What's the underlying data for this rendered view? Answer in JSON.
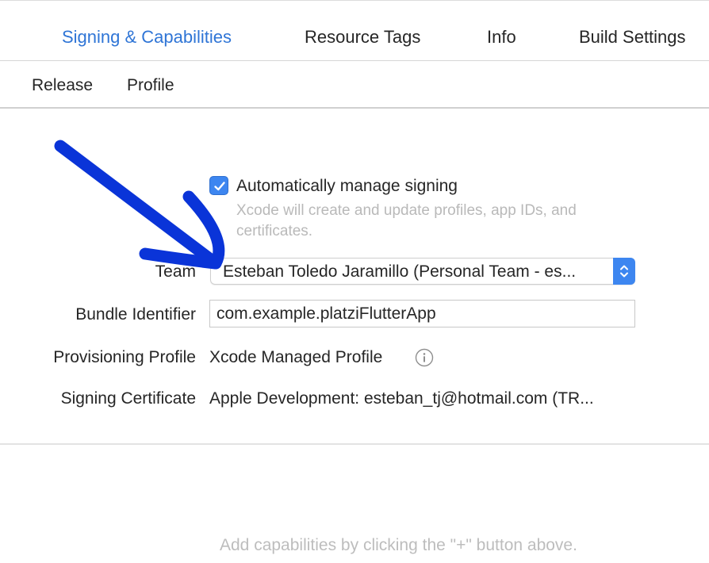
{
  "tabs": [
    {
      "label": "Signing & Capabilities",
      "active": true
    },
    {
      "label": "Resource Tags",
      "active": false
    },
    {
      "label": "Info",
      "active": false
    },
    {
      "label": "Build Settings",
      "active": false
    }
  ],
  "config_tabs": [
    {
      "label": "Release"
    },
    {
      "label": "Profile"
    }
  ],
  "signing": {
    "auto_manage": {
      "checked": true,
      "label": "Automatically manage signing",
      "description": "Xcode will create and update profiles, app IDs, and certificates."
    },
    "team": {
      "label": "Team",
      "value": "Esteban Toledo Jaramillo (Personal Team - es..."
    },
    "bundle_identifier": {
      "label": "Bundle Identifier",
      "value": "com.example.platziFlutterApp"
    },
    "provisioning_profile": {
      "label": "Provisioning Profile",
      "value": "Xcode Managed Profile",
      "icon": "info-icon"
    },
    "signing_certificate": {
      "label": "Signing Certificate",
      "value": "Apple Development: esteban_tj@hotmail.com (TR..."
    }
  },
  "capabilities_hint": "Add capabilities by clicking the \"+\" button above.",
  "colors": {
    "accent": "#3d86f0",
    "active_tab": "#2f75d6",
    "annotation_arrow": "#0a34d8"
  }
}
